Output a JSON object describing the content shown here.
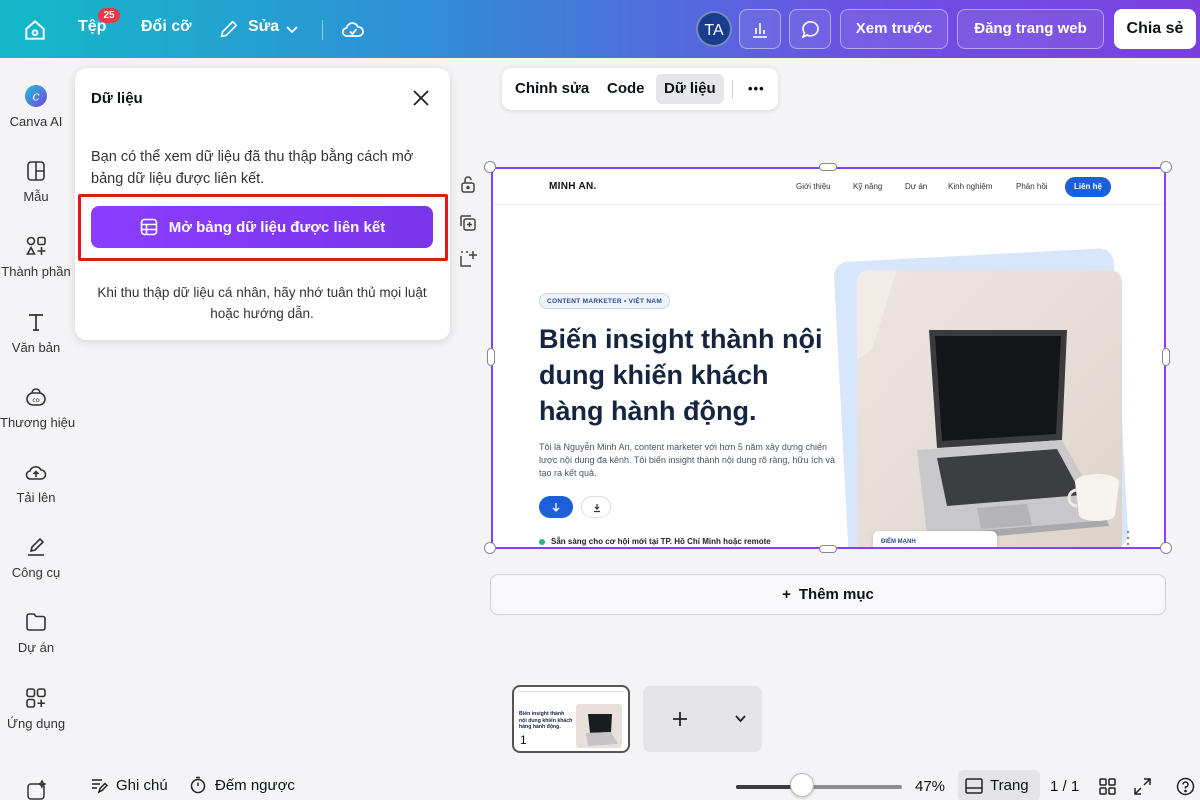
{
  "topbar": {
    "file_label": "Tệp",
    "file_badge": "25",
    "resize_label": "Đổi cỡ",
    "edit_label": "Sửa",
    "avatar_initials": "TA",
    "preview_label": "Xem trước",
    "publish_label": "Đăng trang web",
    "share_label": "Chia sẻ"
  },
  "sidebar": {
    "items": [
      {
        "label": "Canva AI"
      },
      {
        "label": "Mẫu"
      },
      {
        "label": "Thành phần"
      },
      {
        "label": "Văn bản"
      },
      {
        "label": "Thương hiệu"
      },
      {
        "label": "Tải lên"
      },
      {
        "label": "Công cụ"
      },
      {
        "label": "Dự án"
      },
      {
        "label": "Ứng dụng"
      }
    ]
  },
  "panel": {
    "title": "Dữ liệu",
    "description": "Bạn có thể xem dữ liệu đã thu thập bằng cách mở bảng dữ liệu được liên kết.",
    "button_label": "Mở bảng dữ liệu được liên kết",
    "note": "Khi thu thập dữ liệu cá nhân, hãy nhớ tuân thủ mọi luật hoặc hướng dẫn."
  },
  "edit_toolbar": {
    "tabs": [
      "Chỉnh sửa",
      "Code",
      "Dữ liệu"
    ],
    "more_label": "•••"
  },
  "site": {
    "logo": "MINH AN.",
    "nav": [
      "Giới thiệu",
      "Kỹ năng",
      "Dự án",
      "Kinh nghiệm",
      "Phản hồi"
    ],
    "contact": "Liên hệ",
    "pill": "CONTENT MARKETER • VIỆT NAM",
    "title": "Biến insight thành nội dung khiến khách hàng hành động.",
    "description": "Tôi là Nguyễn Minh An, content marketer với hơn 5 năm xây dựng chiến lược nội dung đa kênh. Tôi biến insight thành nội dung rõ ràng, hữu ích và tạo ra kết quả.",
    "status": "Sẵn sàng cho cơ hội mới tại TP. Hồ Chí Minh hoặc remote",
    "card_label": "ĐIỂM MẠNH"
  },
  "add_section_label": "Thêm mục",
  "thumbnail": {
    "page_number": "1",
    "title": "Biến insight thành nội dung khiến khách hàng hành động."
  },
  "bottombar": {
    "notes_label": "Ghi chú",
    "timer_label": "Đếm ngược",
    "zoom_level": "47%",
    "zoom_fraction": 0.4,
    "page_view_label": "Trang",
    "page_count": "1 / 1"
  },
  "colors": {
    "accent": "#8b3dff",
    "highlight": "#e0191f",
    "site_blue": "#1d5fd8"
  }
}
